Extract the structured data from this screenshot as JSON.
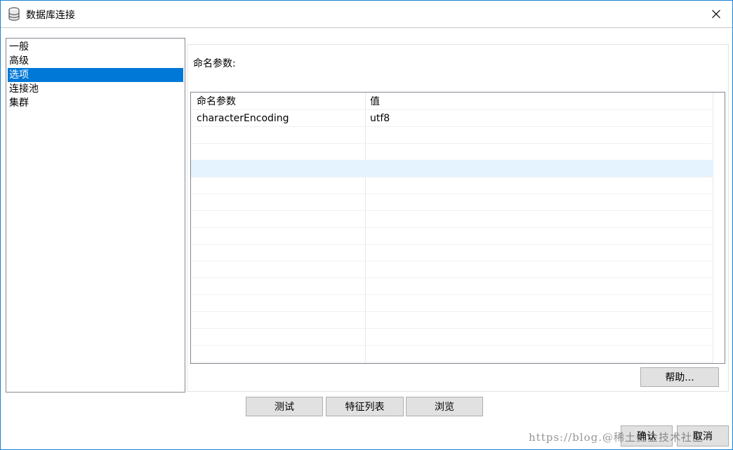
{
  "window": {
    "title": "数据库连接",
    "icon": "database-icon",
    "close_icon": "close-icon"
  },
  "nav": {
    "items": [
      {
        "label": "一般"
      },
      {
        "label": "高级"
      },
      {
        "label": "选项",
        "selected": true
      },
      {
        "label": "连接池"
      },
      {
        "label": "集群"
      }
    ]
  },
  "options": {
    "section_label": "命名参数:",
    "table": {
      "headers": [
        "命名参数",
        "值"
      ],
      "rows": [
        {
          "name": "characterEncoding",
          "value": "utf8"
        }
      ],
      "highlighted_empty_row": 3
    },
    "help_button": "帮助..."
  },
  "bottom": {
    "test_button": "测试",
    "features_button": "特征列表",
    "browse_button": "浏览",
    "ok_button": "确认",
    "cancel_button": "取消"
  },
  "watermark": "https://blog.@稀土掘金技术社区",
  "colors": {
    "selection": "#0078d7",
    "row_highlight": "#e5f3ff",
    "window_border": "#1883d7"
  }
}
